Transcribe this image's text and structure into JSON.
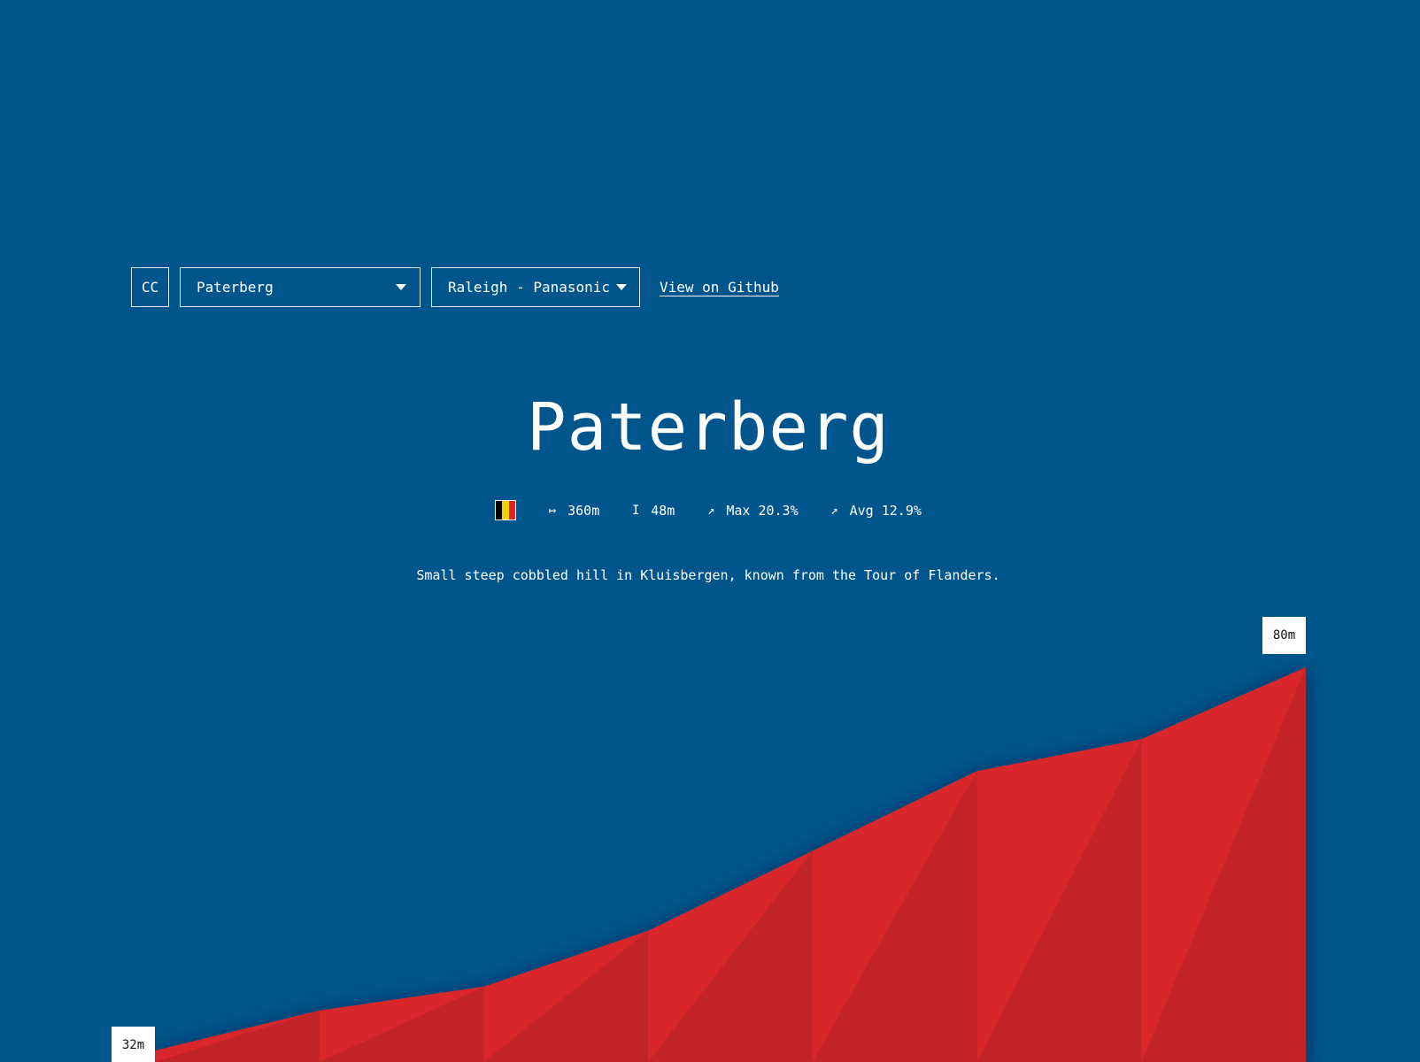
{
  "controls": {
    "cc_label": "CC",
    "climb_select": "Paterberg",
    "theme_select": "Raleigh - Panasonic",
    "github_link": "View on Github"
  },
  "climb": {
    "name": "Paterberg",
    "country_flag": "belgium-flag",
    "flag_colors": [
      "#000000",
      "#f4d200",
      "#e4202c"
    ],
    "length": "360m",
    "elevation_gain": "48m",
    "max_gradient": "Max 20.3%",
    "avg_gradient": "Avg 12.9%",
    "description": "Small steep cobbled hill in Kluisbergen, known from the Tour of Flanders."
  },
  "colors": {
    "background": "#00568c",
    "profile_light": "#d8282c",
    "profile_dark": "#c32428",
    "label_bg": "#ffffff"
  },
  "icons": {
    "length": "horizontal-span-icon",
    "elevation": "vertical-span-icon",
    "max": "arrow-up-right-icon",
    "avg": "arrow-up-right-icon"
  },
  "chart_data": {
    "type": "area",
    "x": [
      0,
      1,
      2,
      3,
      4,
      5,
      6,
      7
    ],
    "values": [
      32,
      37,
      40,
      47,
      57,
      67,
      71,
      80
    ],
    "ylim": [
      32,
      80
    ],
    "min_label": "32m",
    "max_label": "80m"
  }
}
